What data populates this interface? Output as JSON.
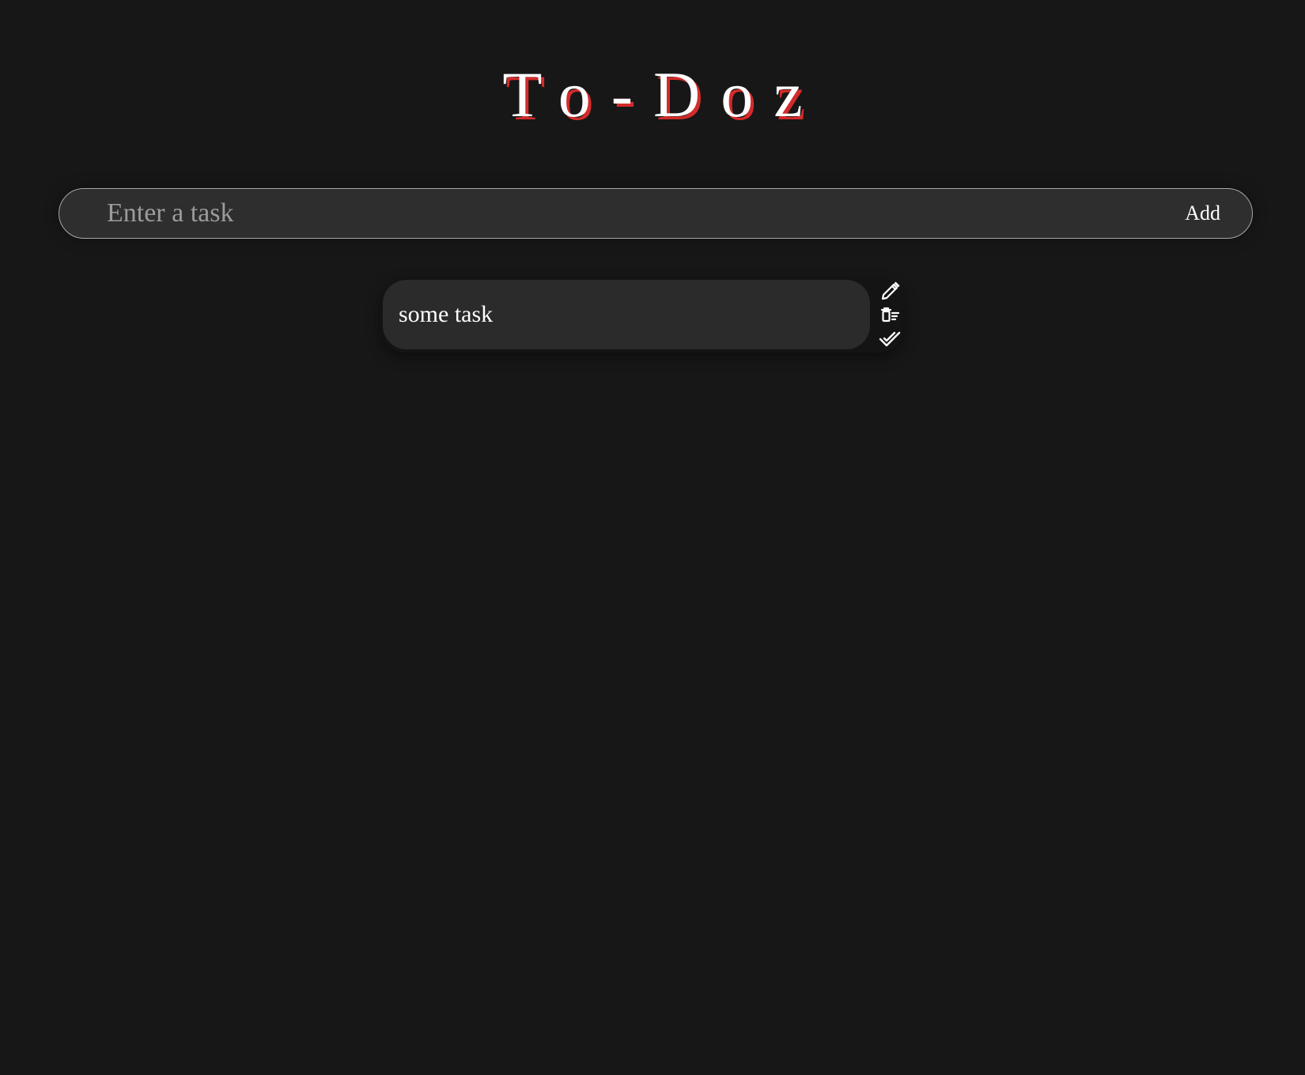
{
  "app": {
    "title": "To-Doz"
  },
  "task_form": {
    "placeholder": "Enter a task",
    "value": "",
    "add_label": "Add"
  },
  "tasks": [
    {
      "text": "some task",
      "actions": [
        "pencil-icon",
        "trash-icon",
        "double-check-icon"
      ]
    }
  ],
  "colors": {
    "background": "#171717",
    "title_shadow": "#d32b2b",
    "input_background": "#2e2e2e",
    "task_background": "#2b2b2b"
  }
}
